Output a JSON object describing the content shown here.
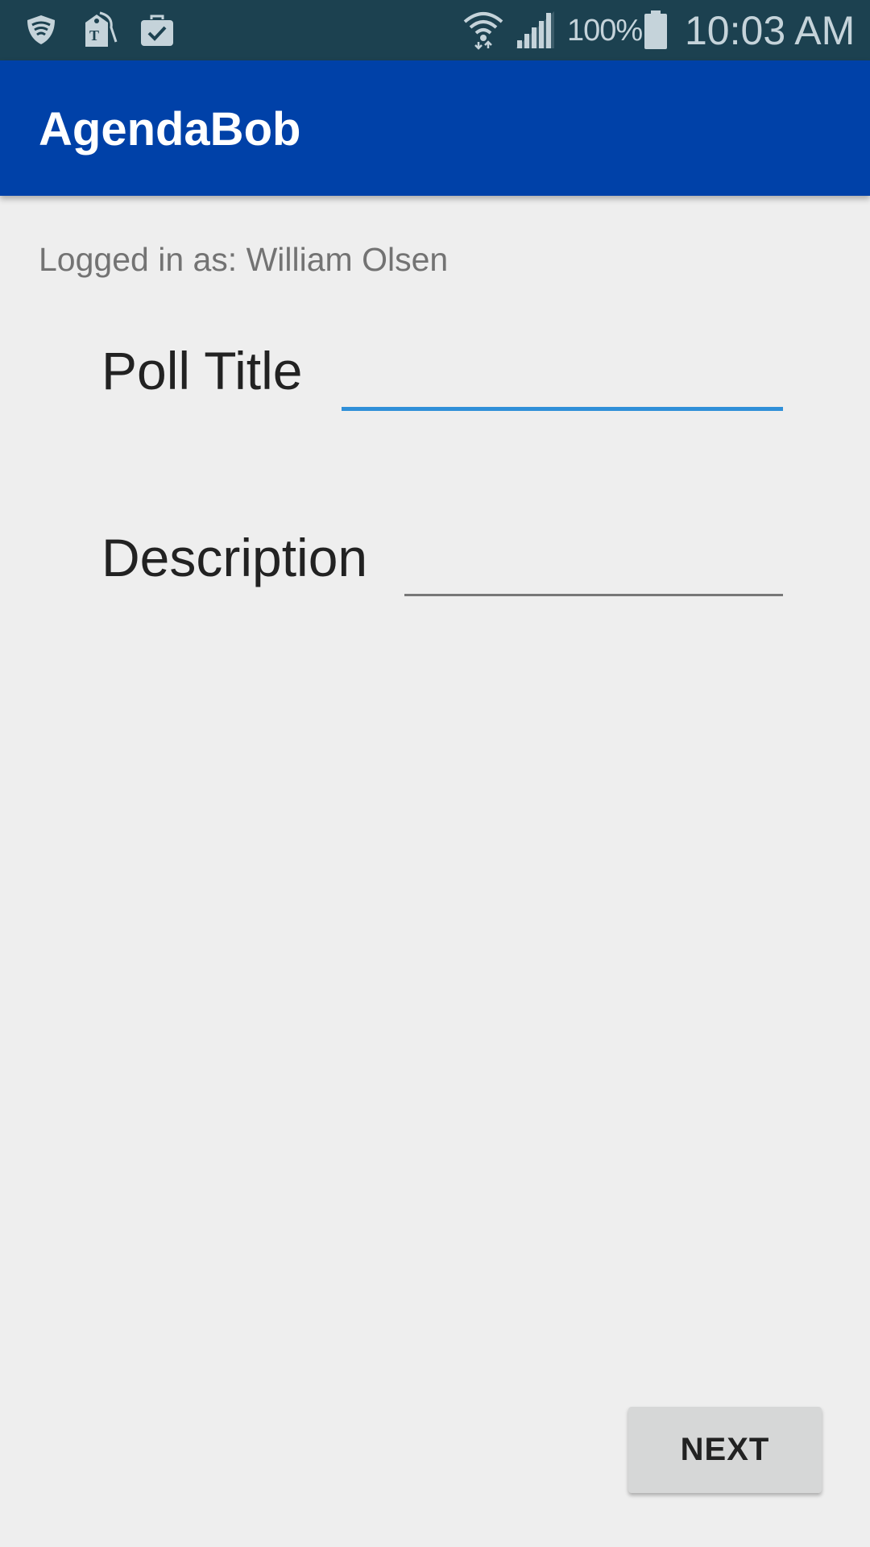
{
  "status_bar": {
    "icons": [
      "shield-icon",
      "tag-icon",
      "briefcase-check-icon",
      "wifi-icon",
      "signal-icon",
      "battery-icon"
    ],
    "battery_percent": "100%",
    "time": "10:03 AM"
  },
  "app_bar": {
    "title": "AgendaBob"
  },
  "session": {
    "logged_in_text": "Logged in as: William Olsen"
  },
  "form": {
    "poll_title_label": "Poll Title",
    "poll_title_value": "",
    "description_label": "Description",
    "description_value": "",
    "next_label": "NEXT"
  },
  "colors": {
    "status_bar": "#1c4150",
    "app_bar": "#0041a8",
    "focused_underline": "#2f8fd8",
    "background": "#eeeeee"
  }
}
